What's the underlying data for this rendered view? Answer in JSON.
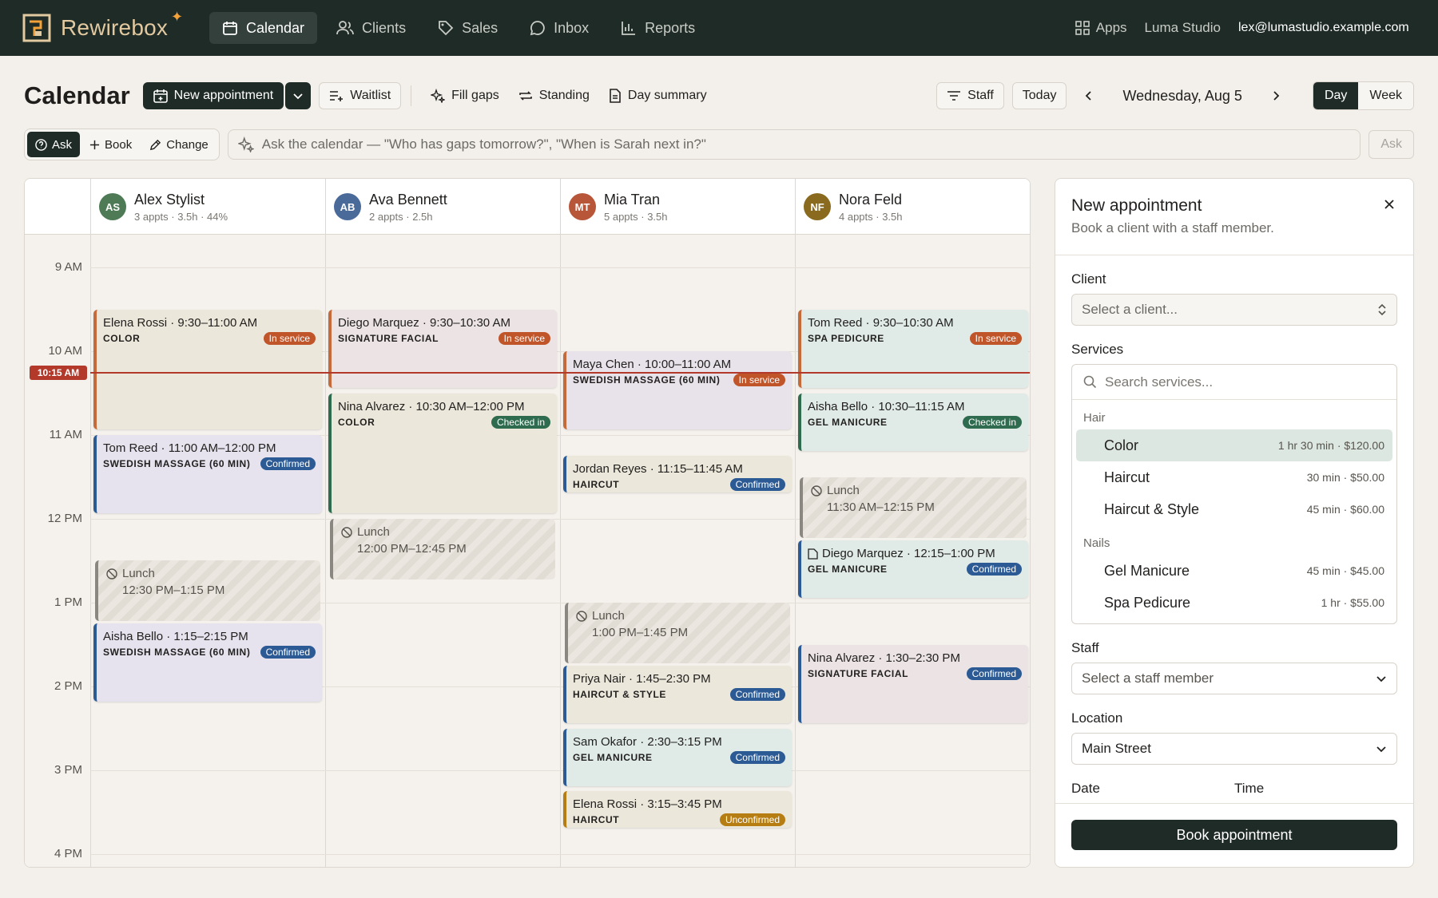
{
  "nav": {
    "brand": "Rewirebox",
    "items": [
      {
        "label": "Calendar",
        "icon": "calendar-icon",
        "active": true
      },
      {
        "label": "Clients",
        "icon": "users-icon"
      },
      {
        "label": "Sales",
        "icon": "tag-icon"
      },
      {
        "label": "Inbox",
        "icon": "chat-icon"
      },
      {
        "label": "Reports",
        "icon": "bar-chart-icon"
      }
    ],
    "apps": "Apps",
    "studio": "Luma Studio",
    "email": "lex@lumastudio.example.com"
  },
  "toolbar": {
    "title": "Calendar",
    "new_appointment": "New appointment",
    "waitlist": "Waitlist",
    "fill_gaps": "Fill gaps",
    "standing": "Standing",
    "day_summary": "Day summary",
    "staff": "Staff",
    "today": "Today",
    "date": "Wednesday, Aug 5",
    "view_day": "Day",
    "view_week": "Week"
  },
  "ask": {
    "modes": [
      "Ask",
      "Book",
      "Change"
    ],
    "placeholder": "Ask the calendar — \"Who has gaps tomorrow?\", \"When is Sarah next in?\"",
    "button": "Ask"
  },
  "calendar": {
    "hours": [
      "9 AM",
      "10 AM",
      "11 AM",
      "12 PM",
      "1 PM",
      "2 PM",
      "3 PM",
      "4 PM"
    ],
    "now": "10:15 AM",
    "staff": [
      {
        "initials": "AS",
        "name": "Alex Stylist",
        "meta": "3 appts · 3.5h · 44%",
        "color": "#4e7a55"
      },
      {
        "initials": "AB",
        "name": "Ava Bennett",
        "meta": "2 appts · 2.5h",
        "color": "#4a6a9a"
      },
      {
        "initials": "MT",
        "name": "Mia Tran",
        "meta": "5 appts · 3.5h",
        "color": "#b8563a"
      },
      {
        "initials": "NF",
        "name": "Nora Feld",
        "meta": "4 appts · 3.5h",
        "color": "#8a6a1e"
      }
    ],
    "events": {
      "a1": {
        "title": "Elena Rossi · 9:30–11:00 AM",
        "service": "COLOR",
        "status": "In service"
      },
      "a2": {
        "title": "Tom Reed · 11:00 AM–12:00 PM",
        "service": "SWEDISH MASSAGE (60 MIN)",
        "status": "Confirmed"
      },
      "a3": {
        "label": "Lunch",
        "time": "12:30 PM–1:15 PM"
      },
      "a4": {
        "title": "Aisha Bello · 1:15–2:15 PM",
        "service": "SWEDISH MASSAGE (60 MIN)",
        "status": "Confirmed"
      },
      "b1": {
        "title": "Diego Marquez · 9:30–10:30 AM",
        "service": "SIGNATURE FACIAL",
        "status": "In service"
      },
      "b2": {
        "title": "Nina Alvarez · 10:30 AM–12:00 PM",
        "service": "COLOR",
        "status": "Checked in"
      },
      "b3": {
        "label": "Lunch",
        "time": "12:00 PM–12:45 PM"
      },
      "m1": {
        "title": "Maya Chen · 10:00–11:00 AM",
        "service": "SWEDISH MASSAGE (60 MIN)",
        "status": "In service"
      },
      "m2": {
        "title": "Jordan Reyes · 11:15–11:45 AM",
        "service": "HAIRCUT",
        "status": "Confirmed"
      },
      "m3": {
        "label": "Lunch",
        "time": "1:00 PM–1:45 PM"
      },
      "m4": {
        "title": "Priya Nair · 1:45–2:30 PM",
        "service": "HAIRCUT & STYLE",
        "status": "Confirmed"
      },
      "m5": {
        "title": "Sam Okafor · 2:30–3:15 PM",
        "service": "GEL MANICURE",
        "status": "Confirmed"
      },
      "m6": {
        "title": "Elena Rossi · 3:15–3:45 PM",
        "service": "HAIRCUT",
        "status": "Unconfirmed"
      },
      "n1": {
        "title": "Tom Reed · 9:30–10:30 AM",
        "service": "SPA PEDICURE",
        "status": "In service"
      },
      "n2": {
        "title": "Aisha Bello · 10:30–11:15 AM",
        "service": "GEL MANICURE",
        "status": "Checked in"
      },
      "n3": {
        "label": "Lunch",
        "time": "11:30 AM–12:15 PM"
      },
      "n4": {
        "title": "Diego Marquez · 12:15–1:00 PM",
        "service": "GEL MANICURE",
        "status": "Confirmed"
      },
      "n5": {
        "title": "Nina Alvarez · 1:30–2:30 PM",
        "service": "SIGNATURE FACIAL",
        "status": "Confirmed"
      }
    }
  },
  "panel": {
    "title": "New appointment",
    "subtitle": "Book a client with a staff member.",
    "client_label": "Client",
    "client_placeholder": "Select a client...",
    "services_label": "Services",
    "services_search": "Search services...",
    "groups": [
      {
        "name": "Hair",
        "items": [
          {
            "name": "Color",
            "meta": "1 hr 30 min · $120.00"
          },
          {
            "name": "Haircut",
            "meta": "30 min · $50.00"
          },
          {
            "name": "Haircut & Style",
            "meta": "45 min · $60.00"
          }
        ]
      },
      {
        "name": "Nails",
        "items": [
          {
            "name": "Gel Manicure",
            "meta": "45 min · $45.00"
          },
          {
            "name": "Spa Pedicure",
            "meta": "1 hr · $55.00"
          }
        ]
      }
    ],
    "staff_label": "Staff",
    "staff_placeholder": "Select a staff member",
    "location_label": "Location",
    "location_value": "Main Street",
    "date_label": "Date",
    "time_label": "Time",
    "book_button": "Book appointment"
  }
}
